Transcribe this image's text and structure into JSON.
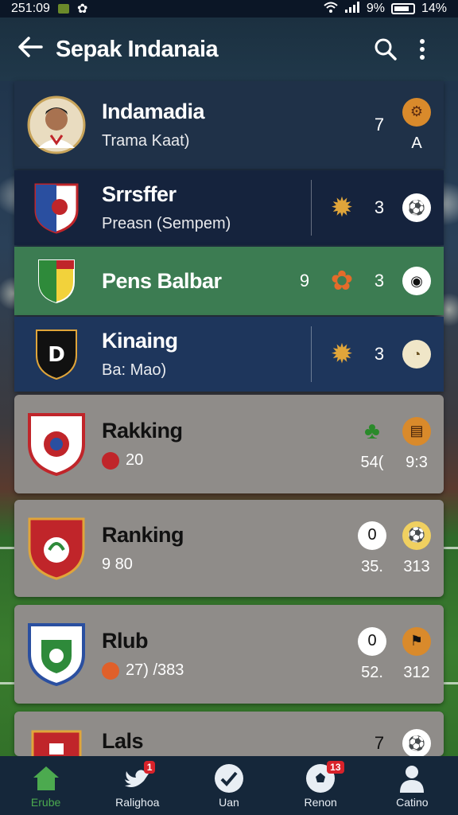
{
  "status_bar": {
    "time": "251:09",
    "signal_text": "9%",
    "battery_text": "14%"
  },
  "app_bar": {
    "back_icon": "arrow-left-icon",
    "title": "Sepak Indanaia",
    "search_icon": "search-icon",
    "menu_icon": "more-vertical-icon"
  },
  "rows": [
    {
      "name": "Indamadia",
      "sub": "Trama Kaat)",
      "num": "7",
      "extra": "A",
      "style": "dark"
    },
    {
      "name": "Srrsffer",
      "sub": "Preasn (Sempem)",
      "num": "3",
      "style": "navy"
    },
    {
      "name": "Pens Balbar",
      "sub": "",
      "pre": "9",
      "num": "3",
      "style": "green"
    },
    {
      "name": "Kinaing",
      "sub": "Ba: Mao)",
      "num": "3",
      "style": "blue"
    },
    {
      "name": "Rakking",
      "sub": "20",
      "stat_left": "54(",
      "stat_right": "9:3",
      "style": "gray"
    },
    {
      "name": "Ranking",
      "sub": "9 80",
      "num": "0",
      "stat_left": "35.",
      "stat_right": "313",
      "style": "gray"
    },
    {
      "name": "Rlub",
      "sub": "27) /383",
      "num": "0",
      "stat_left": "52.",
      "stat_right": "312",
      "style": "gray"
    },
    {
      "name": "Lals",
      "num": "7",
      "style": "gray"
    }
  ],
  "bottom_nav": [
    {
      "label": "Erube",
      "icon": "home-icon",
      "active": true
    },
    {
      "label": "Ralighoa",
      "icon": "bird-icon",
      "badge": "1"
    },
    {
      "label": "Uan",
      "icon": "check-circle-icon"
    },
    {
      "label": "Renon",
      "icon": "soccer-ball-icon",
      "badge": "13"
    },
    {
      "label": "Catino",
      "icon": "user-icon"
    }
  ],
  "colors": {
    "accent_green": "#4caa4f",
    "badge_red": "#d8222a",
    "app_bar": "#1b3040"
  }
}
